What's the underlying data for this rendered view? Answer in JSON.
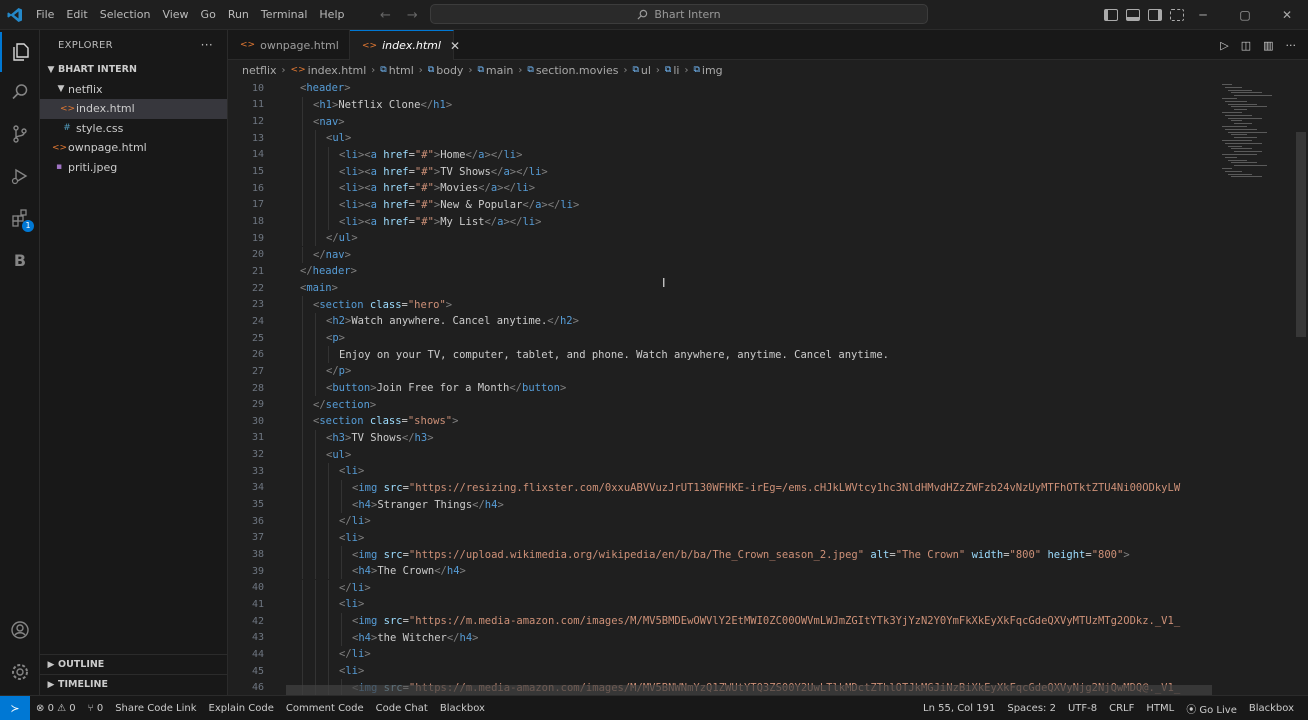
{
  "titlebar": {
    "menu": [
      "File",
      "Edit",
      "Selection",
      "View",
      "Go",
      "Run",
      "Terminal",
      "Help"
    ],
    "search_text": "Bhart Intern"
  },
  "sidebar": {
    "title": "EXPLORER",
    "more": "···",
    "workspace": "BHART INTERN",
    "tree": [
      {
        "label": "netflix",
        "kind": "folder"
      },
      {
        "label": "index.html",
        "kind": "html"
      },
      {
        "label": "style.css",
        "kind": "css"
      },
      {
        "label": "ownpage.html",
        "kind": "html"
      },
      {
        "label": "priti.jpeg",
        "kind": "image"
      }
    ],
    "outline": "OUTLINE",
    "timeline": "TIMELINE"
  },
  "tabs": [
    {
      "label": "ownpage.html",
      "active": false
    },
    {
      "label": "index.html",
      "active": true
    }
  ],
  "breadcrumbs": [
    "netflix",
    "index.html",
    "html",
    "body",
    "main",
    "section.movies",
    "ul",
    "li",
    "img"
  ],
  "activity_badge": "1",
  "code_lines": [
    {
      "n": "10",
      "i": 1,
      "t": [
        [
          "tag",
          "<"
        ],
        [
          "tname",
          "header"
        ],
        [
          "tag",
          ">"
        ]
      ]
    },
    {
      "n": "11",
      "i": 2,
      "t": [
        [
          "tag",
          "<"
        ],
        [
          "tname",
          "h1"
        ],
        [
          "tag",
          ">"
        ],
        [
          "txt",
          "Netflix Clone"
        ],
        [
          "tag",
          "</"
        ],
        [
          "tname",
          "h1"
        ],
        [
          "tag",
          ">"
        ]
      ]
    },
    {
      "n": "12",
      "i": 2,
      "t": [
        [
          "tag",
          "<"
        ],
        [
          "tname",
          "nav"
        ],
        [
          "tag",
          ">"
        ]
      ]
    },
    {
      "n": "13",
      "i": 3,
      "t": [
        [
          "tag",
          "<"
        ],
        [
          "tname",
          "ul"
        ],
        [
          "tag",
          ">"
        ]
      ]
    },
    {
      "n": "14",
      "i": 4,
      "t": [
        [
          "tag",
          "<"
        ],
        [
          "tname",
          "li"
        ],
        [
          "tag",
          "><"
        ],
        [
          "tname",
          "a"
        ],
        [
          "txt",
          " "
        ],
        [
          "attr",
          "href"
        ],
        [
          "txt",
          "="
        ],
        [
          "str",
          "\"#\""
        ],
        [
          "tag",
          ">"
        ],
        [
          "txt",
          "Home"
        ],
        [
          "tag",
          "</"
        ],
        [
          "tname",
          "a"
        ],
        [
          "tag",
          "></"
        ],
        [
          "tname",
          "li"
        ],
        [
          "tag",
          ">"
        ]
      ]
    },
    {
      "n": "15",
      "i": 4,
      "t": [
        [
          "tag",
          "<"
        ],
        [
          "tname",
          "li"
        ],
        [
          "tag",
          "><"
        ],
        [
          "tname",
          "a"
        ],
        [
          "txt",
          " "
        ],
        [
          "attr",
          "href"
        ],
        [
          "txt",
          "="
        ],
        [
          "str",
          "\"#\""
        ],
        [
          "tag",
          ">"
        ],
        [
          "txt",
          "TV Shows"
        ],
        [
          "tag",
          "</"
        ],
        [
          "tname",
          "a"
        ],
        [
          "tag",
          "></"
        ],
        [
          "tname",
          "li"
        ],
        [
          "tag",
          ">"
        ]
      ]
    },
    {
      "n": "16",
      "i": 4,
      "t": [
        [
          "tag",
          "<"
        ],
        [
          "tname",
          "li"
        ],
        [
          "tag",
          "><"
        ],
        [
          "tname",
          "a"
        ],
        [
          "txt",
          " "
        ],
        [
          "attr",
          "href"
        ],
        [
          "txt",
          "="
        ],
        [
          "str",
          "\"#\""
        ],
        [
          "tag",
          ">"
        ],
        [
          "txt",
          "Movies"
        ],
        [
          "tag",
          "</"
        ],
        [
          "tname",
          "a"
        ],
        [
          "tag",
          "></"
        ],
        [
          "tname",
          "li"
        ],
        [
          "tag",
          ">"
        ]
      ]
    },
    {
      "n": "17",
      "i": 4,
      "t": [
        [
          "tag",
          "<"
        ],
        [
          "tname",
          "li"
        ],
        [
          "tag",
          "><"
        ],
        [
          "tname",
          "a"
        ],
        [
          "txt",
          " "
        ],
        [
          "attr",
          "href"
        ],
        [
          "txt",
          "="
        ],
        [
          "str",
          "\"#\""
        ],
        [
          "tag",
          ">"
        ],
        [
          "txt",
          "New & Popular"
        ],
        [
          "tag",
          "</"
        ],
        [
          "tname",
          "a"
        ],
        [
          "tag",
          "></"
        ],
        [
          "tname",
          "li"
        ],
        [
          "tag",
          ">"
        ]
      ]
    },
    {
      "n": "18",
      "i": 4,
      "t": [
        [
          "tag",
          "<"
        ],
        [
          "tname",
          "li"
        ],
        [
          "tag",
          "><"
        ],
        [
          "tname",
          "a"
        ],
        [
          "txt",
          " "
        ],
        [
          "attr",
          "href"
        ],
        [
          "txt",
          "="
        ],
        [
          "str",
          "\"#\""
        ],
        [
          "tag",
          ">"
        ],
        [
          "txt",
          "My List"
        ],
        [
          "tag",
          "</"
        ],
        [
          "tname",
          "a"
        ],
        [
          "tag",
          "></"
        ],
        [
          "tname",
          "li"
        ],
        [
          "tag",
          ">"
        ]
      ]
    },
    {
      "n": "19",
      "i": 3,
      "t": [
        [
          "tag",
          "</"
        ],
        [
          "tname",
          "ul"
        ],
        [
          "tag",
          ">"
        ]
      ]
    },
    {
      "n": "20",
      "i": 2,
      "t": [
        [
          "tag",
          "</"
        ],
        [
          "tname",
          "nav"
        ],
        [
          "tag",
          ">"
        ]
      ]
    },
    {
      "n": "21",
      "i": 1,
      "t": [
        [
          "tag",
          "</"
        ],
        [
          "tname",
          "header"
        ],
        [
          "tag",
          ">"
        ]
      ]
    },
    {
      "n": "22",
      "i": 1,
      "t": [
        [
          "tag",
          "<"
        ],
        [
          "tname",
          "main"
        ],
        [
          "tag",
          ">"
        ]
      ]
    },
    {
      "n": "23",
      "i": 2,
      "t": [
        [
          "tag",
          "<"
        ],
        [
          "tname",
          "section"
        ],
        [
          "txt",
          " "
        ],
        [
          "attr",
          "class"
        ],
        [
          "txt",
          "="
        ],
        [
          "str",
          "\"hero\""
        ],
        [
          "tag",
          ">"
        ]
      ]
    },
    {
      "n": "24",
      "i": 3,
      "t": [
        [
          "tag",
          "<"
        ],
        [
          "tname",
          "h2"
        ],
        [
          "tag",
          ">"
        ],
        [
          "txt",
          "Watch anywhere. Cancel anytime."
        ],
        [
          "tag",
          "</"
        ],
        [
          "tname",
          "h2"
        ],
        [
          "tag",
          ">"
        ]
      ]
    },
    {
      "n": "25",
      "i": 3,
      "t": [
        [
          "tag",
          "<"
        ],
        [
          "tname",
          "p"
        ],
        [
          "tag",
          ">"
        ]
      ]
    },
    {
      "n": "26",
      "i": 4,
      "t": [
        [
          "txt",
          "Enjoy on your TV, computer, tablet, and phone. Watch anywhere, anytime. Cancel anytime."
        ]
      ]
    },
    {
      "n": "27",
      "i": 3,
      "t": [
        [
          "tag",
          "</"
        ],
        [
          "tname",
          "p"
        ],
        [
          "tag",
          ">"
        ]
      ]
    },
    {
      "n": "28",
      "i": 3,
      "t": [
        [
          "tag",
          "<"
        ],
        [
          "tname",
          "button"
        ],
        [
          "tag",
          ">"
        ],
        [
          "txt",
          "Join Free for a Month"
        ],
        [
          "tag",
          "</"
        ],
        [
          "tname",
          "button"
        ],
        [
          "tag",
          ">"
        ]
      ]
    },
    {
      "n": "29",
      "i": 2,
      "t": [
        [
          "tag",
          "</"
        ],
        [
          "tname",
          "section"
        ],
        [
          "tag",
          ">"
        ]
      ]
    },
    {
      "n": "30",
      "i": 2,
      "t": [
        [
          "tag",
          "<"
        ],
        [
          "tname",
          "section"
        ],
        [
          "txt",
          " "
        ],
        [
          "attr",
          "class"
        ],
        [
          "txt",
          "="
        ],
        [
          "str",
          "\"shows\""
        ],
        [
          "tag",
          ">"
        ]
      ]
    },
    {
      "n": "31",
      "i": 3,
      "t": [
        [
          "tag",
          "<"
        ],
        [
          "tname",
          "h3"
        ],
        [
          "tag",
          ">"
        ],
        [
          "txt",
          "TV Shows"
        ],
        [
          "tag",
          "</"
        ],
        [
          "tname",
          "h3"
        ],
        [
          "tag",
          ">"
        ]
      ]
    },
    {
      "n": "32",
      "i": 3,
      "t": [
        [
          "tag",
          "<"
        ],
        [
          "tname",
          "ul"
        ],
        [
          "tag",
          ">"
        ]
      ]
    },
    {
      "n": "33",
      "i": 4,
      "t": [
        [
          "tag",
          "<"
        ],
        [
          "tname",
          "li"
        ],
        [
          "tag",
          ">"
        ]
      ]
    },
    {
      "n": "34",
      "i": 5,
      "t": [
        [
          "tag",
          "<"
        ],
        [
          "tname",
          "img"
        ],
        [
          "txt",
          " "
        ],
        [
          "attr",
          "src"
        ],
        [
          "txt",
          "="
        ],
        [
          "str",
          "\"https://resizing.flixster.com/0xxuABVVuzJrUT130WFHKE-irEg=/ems.cHJkLWVtcy1hc3NldHMvdHZzZWFzb24vNzUyMTFhOTktZTU4Ni00ODkyLW"
        ]
      ]
    },
    {
      "n": "35",
      "i": 5,
      "t": [
        [
          "tag",
          "<"
        ],
        [
          "tname",
          "h4"
        ],
        [
          "tag",
          ">"
        ],
        [
          "txt",
          "Stranger Things"
        ],
        [
          "tag",
          "</"
        ],
        [
          "tname",
          "h4"
        ],
        [
          "tag",
          ">"
        ]
      ]
    },
    {
      "n": "36",
      "i": 4,
      "t": [
        [
          "tag",
          "</"
        ],
        [
          "tname",
          "li"
        ],
        [
          "tag",
          ">"
        ]
      ]
    },
    {
      "n": "37",
      "i": 4,
      "t": [
        [
          "tag",
          "<"
        ],
        [
          "tname",
          "li"
        ],
        [
          "tag",
          ">"
        ]
      ]
    },
    {
      "n": "38",
      "i": 5,
      "t": [
        [
          "tag",
          "<"
        ],
        [
          "tname",
          "img"
        ],
        [
          "txt",
          " "
        ],
        [
          "attr",
          "src"
        ],
        [
          "txt",
          "="
        ],
        [
          "str",
          "\"https://upload.wikimedia.org/wikipedia/en/b/ba/The_Crown_season_2.jpeg\""
        ],
        [
          "txt",
          " "
        ],
        [
          "attr",
          "alt"
        ],
        [
          "txt",
          "="
        ],
        [
          "str",
          "\"The Crown\""
        ],
        [
          "txt",
          " "
        ],
        [
          "attr",
          "width"
        ],
        [
          "txt",
          "="
        ],
        [
          "str",
          "\"800\""
        ],
        [
          "txt",
          " "
        ],
        [
          "attr",
          "height"
        ],
        [
          "txt",
          "="
        ],
        [
          "str",
          "\"800\""
        ],
        [
          "tag",
          ">"
        ]
      ]
    },
    {
      "n": "39",
      "i": 5,
      "t": [
        [
          "tag",
          "<"
        ],
        [
          "tname",
          "h4"
        ],
        [
          "tag",
          ">"
        ],
        [
          "txt",
          "The Crown"
        ],
        [
          "tag",
          "</"
        ],
        [
          "tname",
          "h4"
        ],
        [
          "tag",
          ">"
        ]
      ]
    },
    {
      "n": "40",
      "i": 4,
      "t": [
        [
          "tag",
          "</"
        ],
        [
          "tname",
          "li"
        ],
        [
          "tag",
          ">"
        ]
      ]
    },
    {
      "n": "41",
      "i": 4,
      "t": [
        [
          "tag",
          "<"
        ],
        [
          "tname",
          "li"
        ],
        [
          "tag",
          ">"
        ]
      ]
    },
    {
      "n": "42",
      "i": 5,
      "t": [
        [
          "tag",
          "<"
        ],
        [
          "tname",
          "img"
        ],
        [
          "txt",
          " "
        ],
        [
          "attr",
          "src"
        ],
        [
          "txt",
          "="
        ],
        [
          "str",
          "\"https://m.media-amazon.com/images/M/MV5BMDEwOWVlY2EtMWI0ZC00OWVmLWJmZGItYTk3YjYzN2Y0YmFkXkEyXkFqcGdeQXVyMTUzMTg2ODkz._V1_"
        ]
      ]
    },
    {
      "n": "43",
      "i": 5,
      "t": [
        [
          "tag",
          "<"
        ],
        [
          "tname",
          "h4"
        ],
        [
          "tag",
          ">"
        ],
        [
          "txt",
          "the Witcher"
        ],
        [
          "tag",
          "</"
        ],
        [
          "tname",
          "h4"
        ],
        [
          "tag",
          ">"
        ]
      ]
    },
    {
      "n": "44",
      "i": 4,
      "t": [
        [
          "tag",
          "</"
        ],
        [
          "tname",
          "li"
        ],
        [
          "tag",
          ">"
        ]
      ]
    },
    {
      "n": "45",
      "i": 4,
      "t": [
        [
          "tag",
          "<"
        ],
        [
          "tname",
          "li"
        ],
        [
          "tag",
          ">"
        ]
      ]
    },
    {
      "n": "46",
      "i": 5,
      "t": [
        [
          "tag",
          "<"
        ],
        [
          "tname",
          "img"
        ],
        [
          "txt",
          " "
        ],
        [
          "attr",
          "src"
        ],
        [
          "txt",
          "="
        ],
        [
          "str",
          "\"https://m.media-amazon.com/images/M/MV5BNWNmYzQ1ZWUtYTQ3ZS00Y2UwLTlkMDctZThlOTJkMGJiNzBiXkEyXkFqcGdeQXVyNjg2NjQwMDQ@._V1_"
        ]
      ]
    }
  ],
  "statusbar": {
    "errors": "0",
    "warnings": "0",
    "ports": "0",
    "left_items": [
      "Share Code Link",
      "Explain Code",
      "Comment Code",
      "Code Chat",
      "Blackbox"
    ],
    "position": "Ln 55, Col 191",
    "spaces": "Spaces: 2",
    "encoding": "UTF-8",
    "eol": "CRLF",
    "language": "HTML",
    "golive": "Go Live",
    "blackbox": "Blackbox"
  },
  "colors": {
    "accent": "#0078d4",
    "tag": "#569cd6",
    "attribute": "#9cdcfe",
    "string": "#ce9178",
    "html_icon": "#e37933",
    "css_icon": "#519aba"
  },
  "icons": [
    "vscode-logo-icon",
    "files-icon",
    "search-icon",
    "source-control-icon",
    "run-debug-icon",
    "extensions-icon",
    "blackbox-icon",
    "account-icon",
    "settings-gear-icon",
    "run-icon",
    "split-editor-icon",
    "more-icon"
  ]
}
